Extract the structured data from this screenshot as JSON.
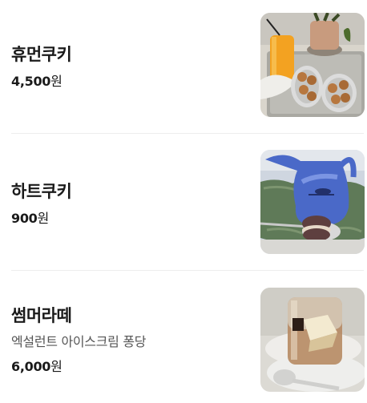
{
  "menu": {
    "items": [
      {
        "name": "휴먼쿠키",
        "price_number": "4,500",
        "price_unit": "원",
        "image": "human-cookie-photo"
      },
      {
        "name": "하트쿠키",
        "price_number": "900",
        "price_unit": "원",
        "image": "heart-cookie-photo"
      },
      {
        "name": "썸머라떼",
        "description": "엑설런트 아이스크림 퐁당",
        "price_number": "6,000",
        "price_unit": "원",
        "image": "summer-latte-photo"
      }
    ]
  }
}
